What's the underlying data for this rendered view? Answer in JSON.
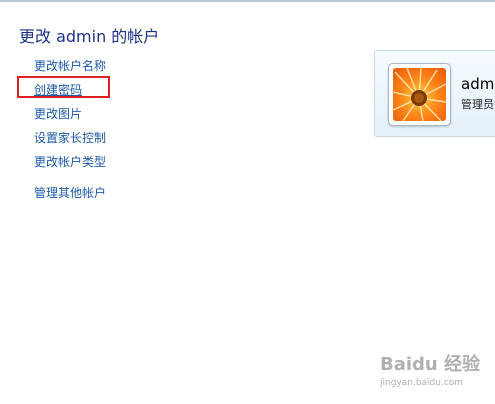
{
  "header": {
    "title": "更改 admin 的帐户"
  },
  "tasks": [
    {
      "label": "更改帐户名称"
    },
    {
      "label": "创建密码"
    },
    {
      "label": "更改图片"
    },
    {
      "label": "设置家长控制"
    },
    {
      "label": "更改帐户类型"
    },
    {
      "label": "管理其他帐户"
    }
  ],
  "account": {
    "name": "adm",
    "type": "管理员"
  },
  "watermark": {
    "brand": "Baidu 经验",
    "url": "jingyan.baidu.com"
  },
  "colors": {
    "link": "#1e5aa8",
    "title": "#1e3287",
    "highlight": "#e02020"
  }
}
